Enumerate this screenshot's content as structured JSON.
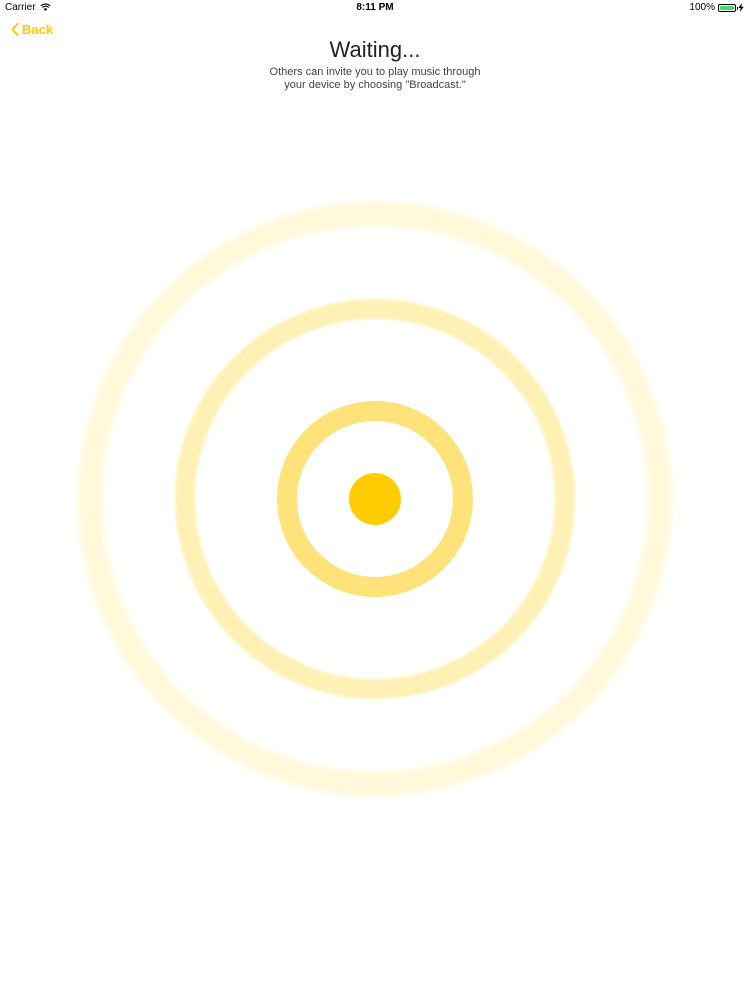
{
  "status_bar": {
    "carrier": "Carrier",
    "time": "8:11 PM",
    "battery_percent": "100%",
    "battery_level": 1.0,
    "battery_color": "#4cd964",
    "wifi_icon": "wifi-icon",
    "charging_icon": "bolt-icon"
  },
  "nav": {
    "back_label": "Back",
    "back_icon": "chevron-left-icon"
  },
  "header": {
    "title": "Waiting...",
    "subtitle_line1": "Others can invite you to play music through",
    "subtitle_line2": "your device by choosing \"Broadcast.\""
  },
  "colors": {
    "accent": "#ffcc00",
    "ring_inner": "#ffe27a",
    "ring_middle": "#fff1b5",
    "ring_outer": "#fff8d9"
  }
}
